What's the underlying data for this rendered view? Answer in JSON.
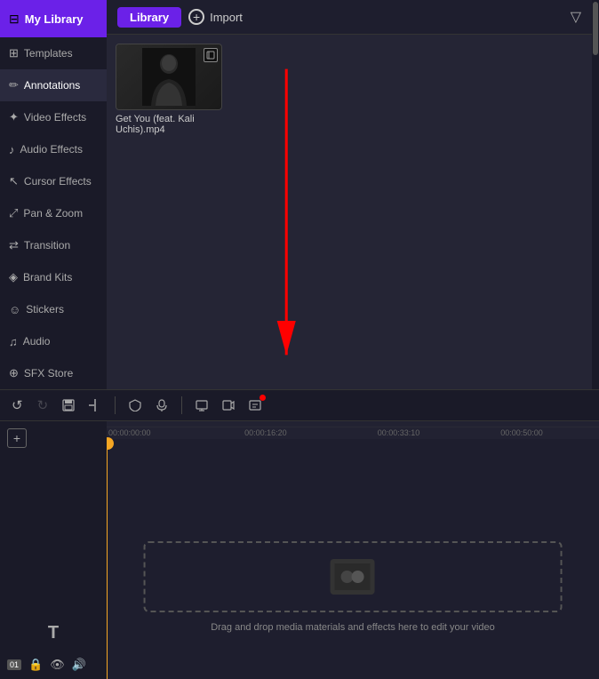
{
  "sidebar": {
    "my_library_label": "My Library",
    "items": [
      {
        "id": "templates",
        "label": "Templates",
        "icon": "⊞"
      },
      {
        "id": "annotations",
        "label": "Annotations",
        "icon": "✏"
      },
      {
        "id": "video-effects",
        "label": "Video Effects",
        "icon": "✦"
      },
      {
        "id": "audio-effects",
        "label": "Audio Effects",
        "icon": "♪"
      },
      {
        "id": "cursor-effects",
        "label": "Cursor Effects",
        "icon": "↖"
      },
      {
        "id": "pan-zoom",
        "label": "Pan & Zoom",
        "icon": "⤢"
      },
      {
        "id": "transition",
        "label": "Transition",
        "icon": "⇄"
      },
      {
        "id": "brand-kits",
        "label": "Brand Kits",
        "icon": "🎨"
      },
      {
        "id": "stickers",
        "label": "Stickers",
        "icon": "☺"
      },
      {
        "id": "audio",
        "label": "Audio",
        "icon": "♫"
      },
      {
        "id": "sfx-store",
        "label": "SFX Store",
        "icon": "🛒"
      }
    ]
  },
  "panel": {
    "tab_label": "Library",
    "import_label": "Import",
    "filter_icon": "▽"
  },
  "media": {
    "filename": "Get You (feat. Kali Uchis).mp4"
  },
  "toolbar": {
    "undo_label": "↺",
    "redo_label": "↻",
    "cut_label": "✂",
    "split_label": "⊣",
    "shield_label": "⛉",
    "mic_label": "🎤",
    "screen_label": "▣",
    "webcam_label": "⧉",
    "annotate_label": "✐"
  },
  "timeline": {
    "ruler_timestamps": [
      "00:00:00:00",
      "00:00:16:20",
      "00:00:33:10",
      "00:00:50:00"
    ],
    "drop_text": "Drag and drop media materials and effects here to edit your video",
    "add_icon": "+",
    "text_icon": "T"
  },
  "timeline_bottom": {
    "badge": "01",
    "lock_icon": "🔒",
    "eye_icon": "👁",
    "audio_icon": "🔊"
  }
}
